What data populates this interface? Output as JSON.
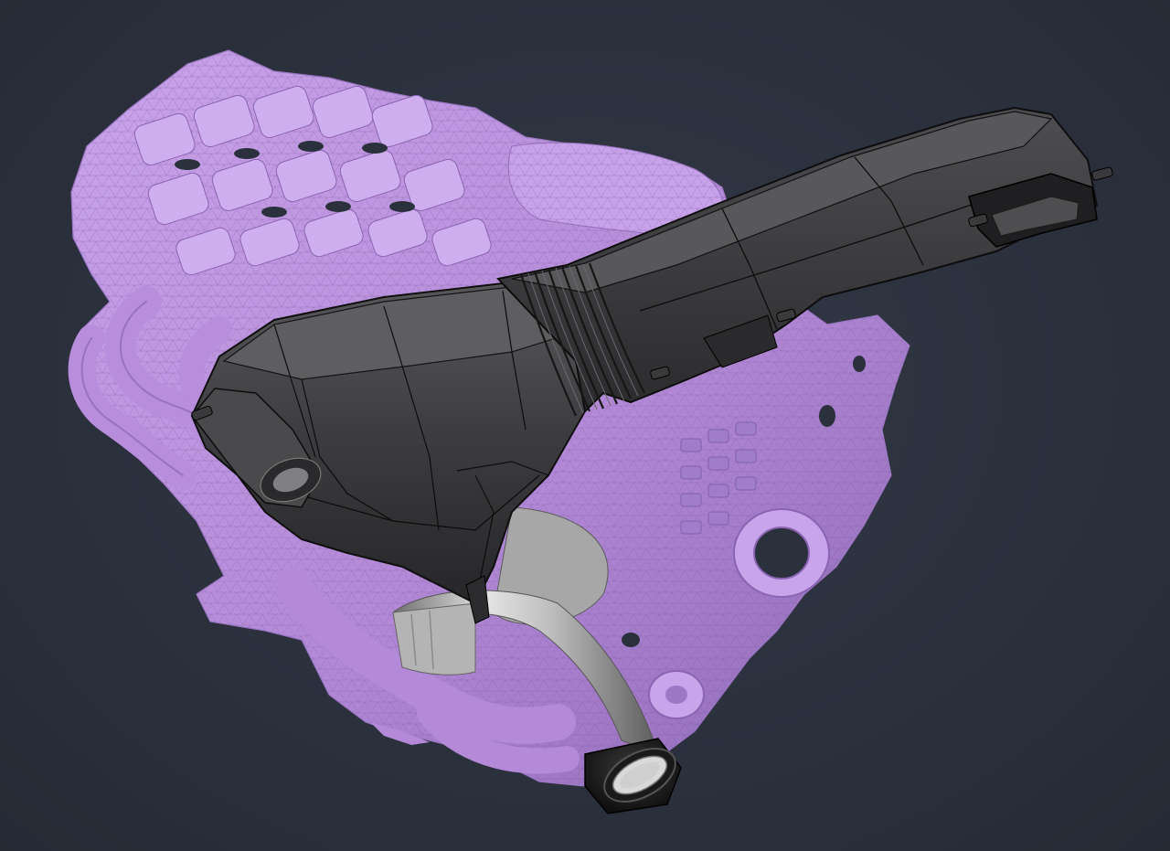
{
  "viewport": {
    "background": "#2b303d"
  },
  "colors": {
    "engine_mesh_fill": "#b98fdc",
    "engine_mesh_dark": "#8c66b4",
    "engine_mesh_line": "#7a5a9c",
    "airbox_fill": "#3e3e40",
    "airbox_edge": "#0f0f10",
    "airbox_highlight": "#6a6a6c",
    "pipe_light": "#d8d8d8",
    "pipe_dark": "#7b7b7b",
    "coupler": "#1b1b1c"
  },
  "parts": [
    {
      "name": "engine-scan-mesh",
      "render_style": "triangulated mesh"
    },
    {
      "name": "air-intake-duct",
      "render_style": "shaded with edges"
    },
    {
      "name": "air-filter-box",
      "render_style": "shaded with edges"
    },
    {
      "name": "intake-pipe",
      "render_style": "shaded"
    },
    {
      "name": "pipe-coupler",
      "render_style": "shaded"
    }
  ]
}
